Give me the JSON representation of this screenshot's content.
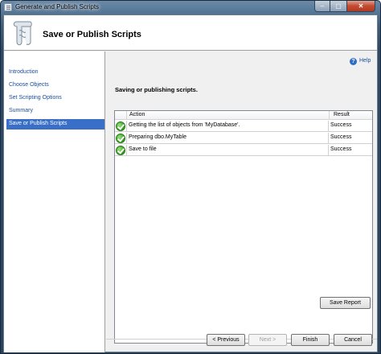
{
  "window": {
    "title": "Generate and Publish Scripts",
    "controls": {
      "minimize": "–",
      "maximize": "▢",
      "close": "✕"
    }
  },
  "header": {
    "title": "Save or Publish Scripts",
    "icon": "script-scroll-icon"
  },
  "nav": {
    "items": [
      {
        "label": "Introduction",
        "selected": false
      },
      {
        "label": "Choose Objects",
        "selected": false
      },
      {
        "label": "Set Scripting Options",
        "selected": false
      },
      {
        "label": "Summary",
        "selected": false
      },
      {
        "label": "Save or Publish Scripts",
        "selected": true
      }
    ]
  },
  "help": {
    "label": "Help",
    "icon": "help-icon",
    "glyph": "?"
  },
  "status_text": "Saving or publishing scripts.",
  "grid": {
    "columns": {
      "action": "Action",
      "result": "Result"
    },
    "rows": [
      {
        "action": "Getting the list of objects from 'MyDatabase'.",
        "result": "Success",
        "status": "success"
      },
      {
        "action": "Preparing dbo.MyTable",
        "result": "Success",
        "status": "success"
      },
      {
        "action": "Save to file",
        "result": "Success",
        "status": "success"
      }
    ]
  },
  "buttons": {
    "save_report": "Save Report",
    "previous": "< Previous",
    "next": "Next >",
    "finish": "Finish",
    "cancel": "Cancel"
  },
  "colors": {
    "selected_nav": "#3a6fc8",
    "link": "#1a4fa0",
    "success": "#2f9a1e"
  }
}
